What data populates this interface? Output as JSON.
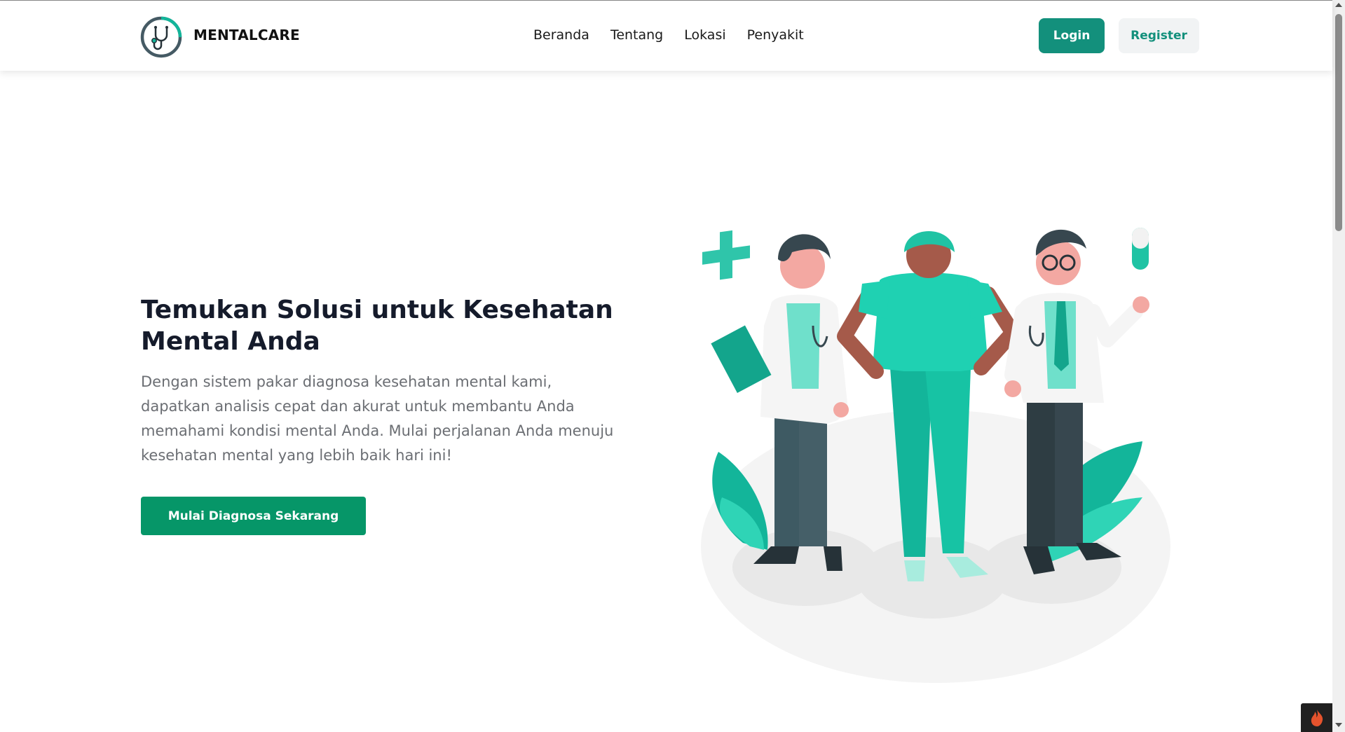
{
  "header": {
    "brand_name": "MENTALCARE",
    "nav": [
      {
        "label": "Beranda"
      },
      {
        "label": "Tentang"
      },
      {
        "label": "Lokasi"
      },
      {
        "label": "Penyakit"
      }
    ],
    "login_label": "Login",
    "register_label": "Register"
  },
  "hero": {
    "title": "Temukan Solusi untuk Kesehatan Mental Anda",
    "description": "Dengan sistem pakar diagnosa kesehatan mental kami, dapatkan analisis cepat dan akurat untuk membantu Anda memahami kondisi mental Anda. Mulai perjalanan Anda menuju kesehatan mental yang lebih baik hari ini!",
    "cta_label": "Mulai Diagnosa Sekarang"
  },
  "icons": {
    "brand_logo": "stethoscope-icon",
    "debug_badge": "flame-icon"
  },
  "colors": {
    "primary": "#13907c",
    "cta": "#069668",
    "title": "#151b2b",
    "body_text": "#6b6e73",
    "register_bg": "#f1f3f4"
  }
}
